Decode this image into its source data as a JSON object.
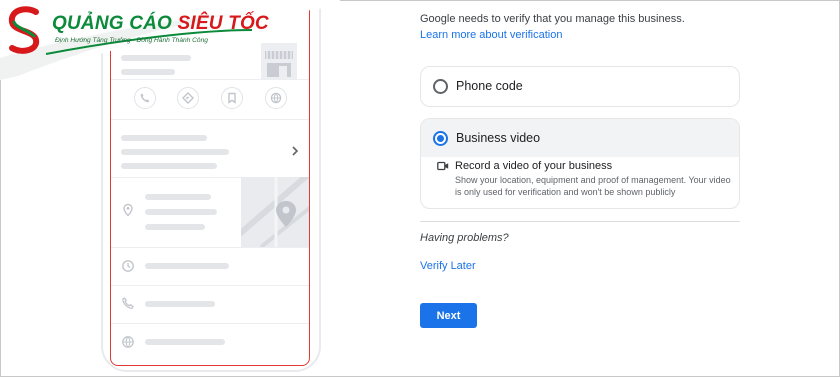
{
  "logo": {
    "brand_part1": "QUẢNG CÁO",
    "brand_part2": "SIÊU TỐC",
    "tagline": "Định Hướng Tăng Trưởng - Đồng Hành Thành Công"
  },
  "verification": {
    "intro": "Google needs to verify that you manage this business.",
    "learn_more": "Learn more about verification",
    "options": [
      {
        "label": "Phone code",
        "selected": false
      },
      {
        "label": "Business video",
        "selected": true,
        "detail_title": "Record a video of your business",
        "detail_desc": "Show your location, equipment and proof of management. Your video is only used for verification and won't be shown publicly"
      }
    ],
    "problems": "Having problems?",
    "verify_later": "Verify Later",
    "next": "Next"
  },
  "icons": {
    "phone": "phone-icon",
    "directions": "directions-icon",
    "save": "bookmark-icon",
    "website": "globe-icon",
    "location": "location-pin-icon",
    "hours": "clock-icon",
    "call": "phone-icon",
    "web": "globe-icon",
    "video": "videocam-icon"
  },
  "colors": {
    "accent": "#1a73e8",
    "brand_green": "#0b8a3a",
    "brand_red": "#d7191c",
    "mock_outline": "#e53935"
  }
}
